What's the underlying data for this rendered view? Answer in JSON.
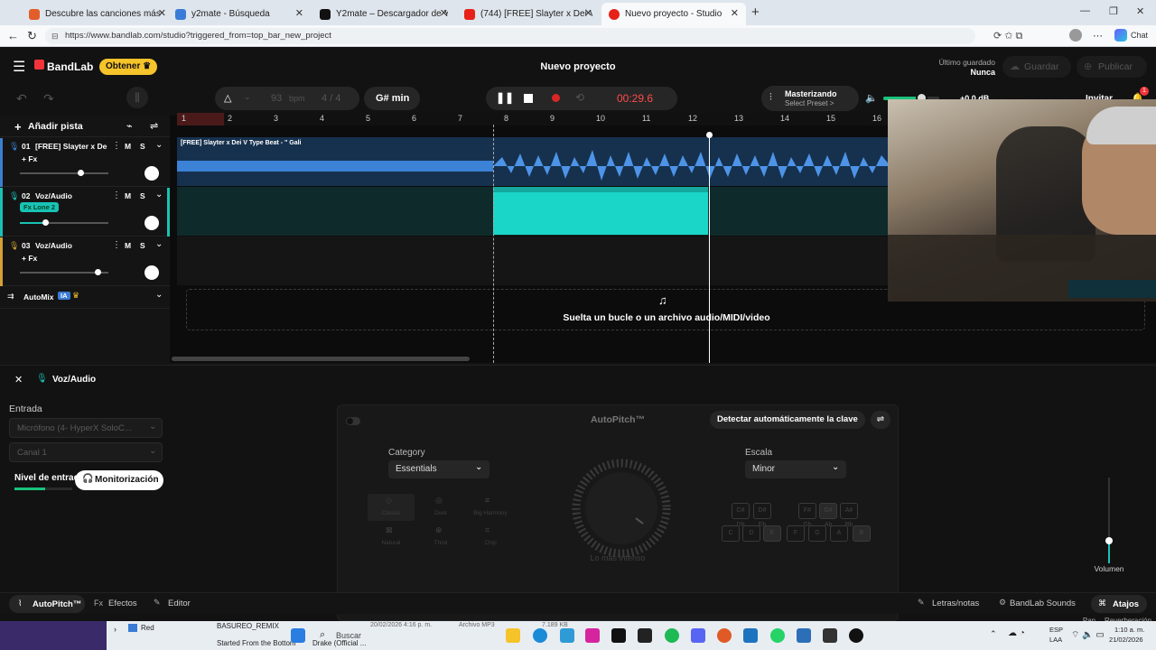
{
  "browser": {
    "tabs": [
      {
        "label": "Descubre las canciones más escuc",
        "color": "#e35d2b"
      },
      {
        "label": "y2mate - Búsqueda",
        "color": "#3a7bd5"
      },
      {
        "label": "Y2mate – Descargador de YouTub",
        "color": "#111111"
      },
      {
        "label": "(744) [FREE] Slayter x Dei V Type B",
        "color": "#e62117"
      },
      {
        "label": "Nuevo proyecto - Studio",
        "color": "#e62117"
      }
    ],
    "url": "https://www.bandlab.com/studio?triggered_from=top_bar_new_project",
    "chat_label": "Chat"
  },
  "app": {
    "logo": "BandLab",
    "get_button": "Obtener",
    "project_title": "Nuevo proyecto",
    "last_saved_label": "Último guardado",
    "last_saved_value": "Nunca",
    "save_button": "Guardar",
    "publish_button": "Publicar",
    "bpm_value": "93",
    "bpm_label": "bpm",
    "time_sig": "4 / 4",
    "key": "G# min",
    "time": "00:29.6",
    "mastering_title": "Masterizando",
    "mastering_sub": "Select Preset >",
    "volume_db": "+0.0 dB",
    "invite_button": "Invitar",
    "notif_count": "1"
  },
  "tracks": {
    "add_track": "Añadir pista",
    "items": [
      {
        "number": "01",
        "name": "[FREE] Slayter x Dei...",
        "fx": "+ Fx",
        "mute": "M",
        "solo": "S",
        "color": "#3b7fd0"
      },
      {
        "number": "02",
        "name": "Voz/Audio",
        "fx": "Fx Lone 2",
        "mute": "M",
        "solo": "S",
        "color": "#19c2b5"
      },
      {
        "number": "03",
        "name": "Voz/Audio",
        "fx": "+ Fx",
        "mute": "M",
        "solo": "S",
        "color": "#d6a133"
      }
    ],
    "automix": "AutoMix",
    "automix_badge": "IA",
    "clip_title": "[FREE] Slayter x Dei V Type Beat - \" Gali",
    "drop_hint": "Suelta un bucle o un archivo audio/MIDI/video",
    "ruler": [
      "1",
      "2",
      "3",
      "4",
      "5",
      "6",
      "7",
      "8",
      "9",
      "10",
      "11",
      "12",
      "13",
      "14",
      "15",
      "16"
    ]
  },
  "panel": {
    "track_name": "Voz/Audio",
    "input_label": "Entrada",
    "input_device": "Micrófono (4- HyperX SoloC...",
    "channel": "Canal 1",
    "input_level_label": "Nivel de entrada",
    "monitor_button": "Monitorización",
    "autopitch_title": "AutoPitch™",
    "detect_key": "Detectar automáticamente la clave",
    "category_label": "Category",
    "category_value": "Essentials",
    "scale_label": "Escala",
    "scale_value": "Minor",
    "presets": [
      "Classic",
      "Duet",
      "Big Harmony",
      "Natural",
      "Third",
      "Chip"
    ],
    "knob_label": "Lo más intenso",
    "sharp_keys": [
      "C# Db",
      "D# Eb",
      "F# Gb",
      "G# Ab",
      "A# Bb"
    ],
    "natural_keys": [
      "C",
      "D",
      "E",
      "F",
      "G",
      "A",
      "B"
    ],
    "volume_label": "Volumen",
    "pan_label": "Pan",
    "reverb_label": "Reverberación"
  },
  "footer": {
    "tab_autopitch": "AutoPitch™",
    "tab_effects": "Efectos",
    "tab_editor": "Editor",
    "lyrics": "Letras/notas",
    "sounds": "BandLab Sounds",
    "shortcuts": "Atajos"
  },
  "taskbar": {
    "search": "Buscar",
    "net_label": "Red",
    "file1": "BASUREO_REMIX",
    "file2": "Started From the Bottom",
    "file2_b": "Drake (Official ...",
    "date1": "20/02/2026 4:16 p. m.",
    "file_type": "Archivo MP3",
    "size": "7.189 KB",
    "lang": "ESP",
    "lang_sub": "LAA",
    "clock_time": "1:10 a. m.",
    "clock_date": "21/02/2026"
  }
}
